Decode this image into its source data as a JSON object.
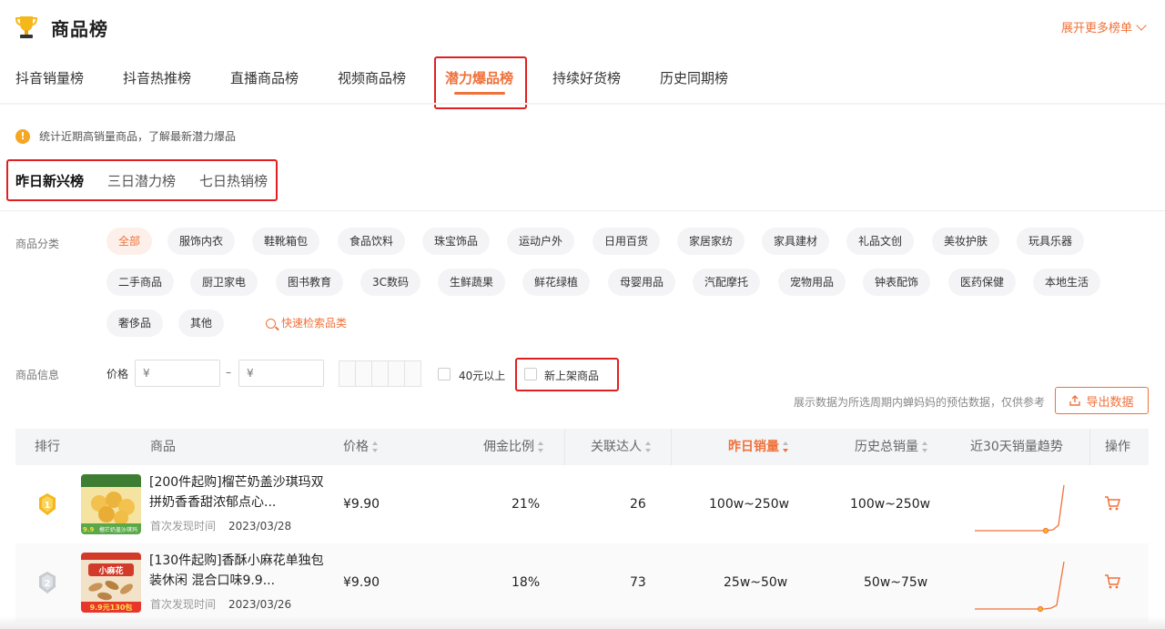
{
  "header": {
    "title": "商品榜",
    "expand_more": "展开更多榜单"
  },
  "main_tabs": [
    {
      "label": "抖音销量榜",
      "active": false
    },
    {
      "label": "抖音热推榜",
      "active": false
    },
    {
      "label": "直播商品榜",
      "active": false
    },
    {
      "label": "视频商品榜",
      "active": false
    },
    {
      "label": "潜力爆品榜",
      "active": true
    },
    {
      "label": "持续好货榜",
      "active": false
    },
    {
      "label": "历史同期榜",
      "active": false
    }
  ],
  "notice": "统计近期高销量商品，了解最新潜力爆品",
  "sub_tabs": [
    {
      "label": "昨日新兴榜",
      "active": true
    },
    {
      "label": "三日潜力榜",
      "active": false
    },
    {
      "label": "七日热销榜",
      "active": false
    }
  ],
  "filters": {
    "category_label": "商品分类",
    "categories": [
      "全部",
      "服饰内衣",
      "鞋靴箱包",
      "食品饮料",
      "珠宝饰品",
      "运动户外",
      "日用百货",
      "家居家纺",
      "家具建材",
      "礼品文创",
      "美妆护肤",
      "玩具乐器",
      "二手商品",
      "厨卫家电",
      "图书教育",
      "3C数码",
      "生鲜蔬果",
      "鲜花绿植",
      "母婴用品",
      "汽配摩托",
      "宠物用品",
      "钟表配饰",
      "医药保健",
      "本地生活",
      "奢侈品",
      "其他"
    ],
    "active_category": "全部",
    "search_category": "快速检索品类",
    "info_label": "商品信息",
    "price_label": "价格",
    "price_min_placeholder": "¥",
    "price_max_placeholder": "¥",
    "price_dash": "–",
    "over_40": "40元以上",
    "new_listed": "新上架商品"
  },
  "data_note": "展示数据为所选周期内蝉妈妈的预估数据，仅供参考",
  "export_label": "导出数据",
  "table": {
    "headers": {
      "rank": "排行",
      "product": "商品",
      "price": "价格",
      "commission": "佣金比例",
      "influencers": "关联达人",
      "yesterday_sales": "昨日销量",
      "total_sales": "历史总销量",
      "trend": "近30天销量趋势",
      "action": "操作"
    },
    "rows": [
      {
        "rank": "1",
        "name": "[200件起购]榴芒奶盖沙琪玛双拼奶香香甜浓郁点心...",
        "first_found_label": "首次发现时间",
        "first_found": "2023/03/28",
        "price": "¥9.90",
        "commission": "21%",
        "influencers": "26",
        "yesterday_sales": "100w~250w",
        "total_sales": "100w~250w",
        "thumb_label": "榴芒奶盖沙琪玛",
        "thumb_price": "9.9"
      },
      {
        "rank": "2",
        "name": "[130件起购]香酥小麻花单独包装休闲 混合口味9.9...",
        "first_found_label": "首次发现时间",
        "first_found": "2023/03/26",
        "price": "¥9.90",
        "commission": "18%",
        "influencers": "73",
        "yesterday_sales": "25w~50w",
        "total_sales": "50w~75w",
        "thumb_label": "小麻花",
        "thumb_price": "9.9元130包"
      }
    ]
  },
  "colors": {
    "accent": "#f0713a",
    "highlight_box": "#e02020",
    "gold": "#f5b81c",
    "silver": "#b8bcc4"
  }
}
